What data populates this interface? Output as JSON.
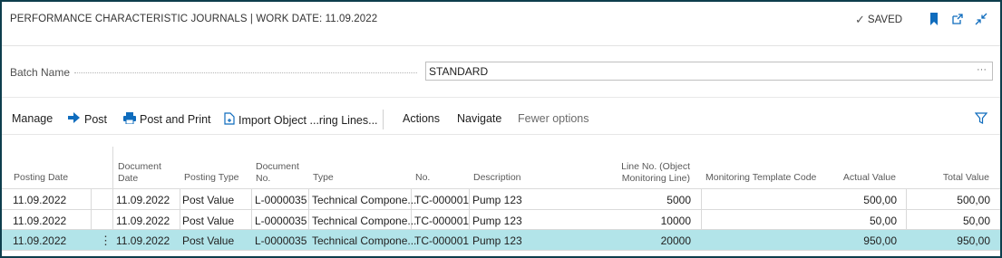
{
  "header": {
    "title": "PERFORMANCE CHARACTERISTIC JOURNALS | WORK DATE: 11.09.2022",
    "saved_label": "SAVED",
    "accent_color": "#0f6cbd"
  },
  "batch": {
    "label": "Batch Name",
    "value": "STANDARD",
    "more": "···"
  },
  "toolbar": {
    "manage": "Manage",
    "post": "Post",
    "post_and_print": "Post and Print",
    "import_object": "Import Object ...ring Lines...",
    "actions": "Actions",
    "navigate": "Navigate",
    "fewer_options": "Fewer options"
  },
  "grid": {
    "columns": {
      "posting_date": "Posting Date",
      "document_date_1": "Document",
      "document_date_2": "Date",
      "posting_type": "Posting Type",
      "document_no_1": "Document",
      "document_no_2": "No.",
      "type": "Type",
      "no": "No.",
      "description": "Description",
      "line_no_1": "Line No. (Object",
      "line_no_2": "Monitoring Line)",
      "template_code": "Monitoring Template Code",
      "actual_value": "Actual Value",
      "total_value": "Total Value"
    },
    "rows": [
      {
        "posting_date": "11.09.2022",
        "document_date": "11.09.2022",
        "posting_type": "Post Value",
        "document_no": "L-0000035",
        "type": "Technical Compone...",
        "no": "TC-000001",
        "description": "Pump 123",
        "line_no": "5000",
        "template_code": "",
        "actual_value": "500,00",
        "total_value": "500,00"
      },
      {
        "posting_date": "11.09.2022",
        "document_date": "11.09.2022",
        "posting_type": "Post Value",
        "document_no": "L-0000035",
        "type": "Technical Compone...",
        "no": "TC-000001",
        "description": "Pump 123",
        "line_no": "10000",
        "template_code": "",
        "actual_value": "50,00",
        "total_value": "50,00"
      },
      {
        "posting_date": "11.09.2022",
        "document_date": "11.09.2022",
        "posting_type": "Post Value",
        "document_no": "L-0000035",
        "type": "Technical Compone...",
        "no": "TC-000001",
        "description": "Pump 123",
        "line_no": "20000",
        "template_code": "",
        "actual_value": "950,00",
        "total_value": "950,00",
        "selected": true
      }
    ],
    "row_menu": "⋮"
  }
}
